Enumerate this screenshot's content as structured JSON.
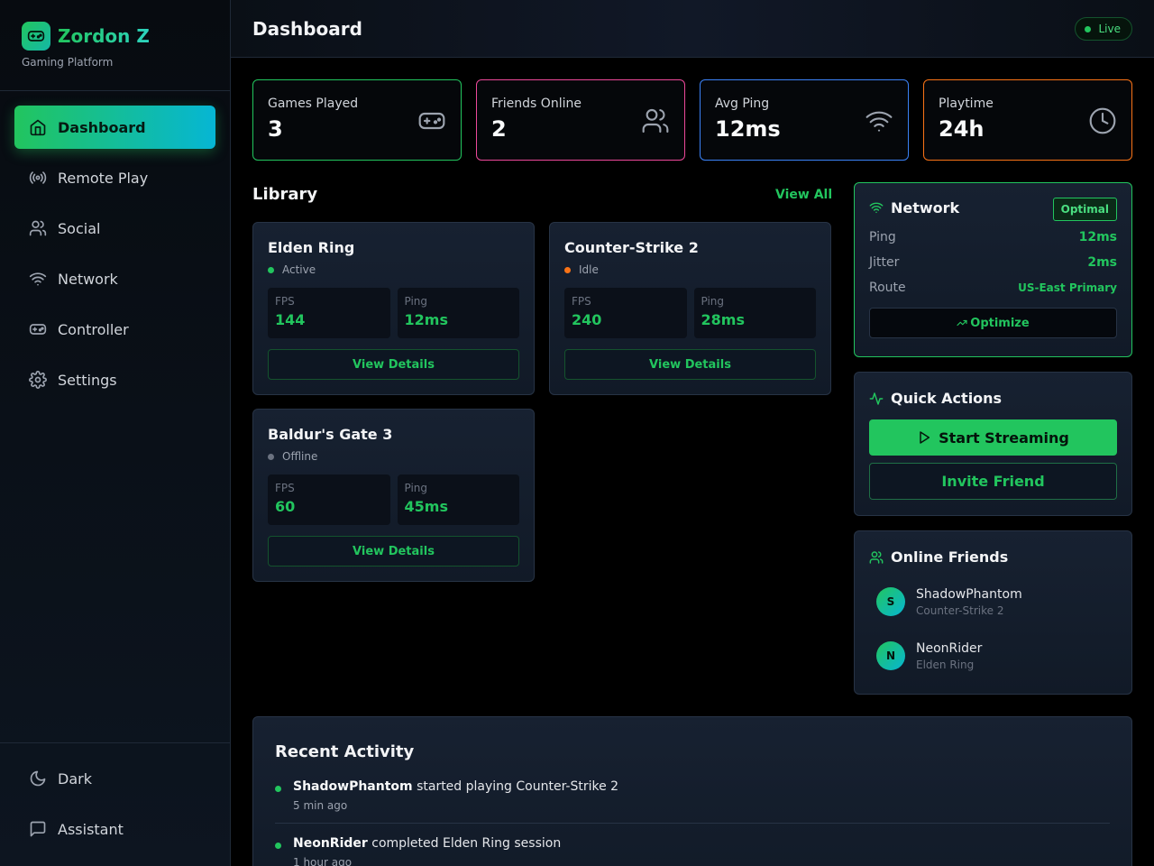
{
  "brand": {
    "name": "Zordon Z",
    "subtitle": "Gaming Platform"
  },
  "nav": {
    "items": [
      {
        "label": "Dashboard",
        "icon": "home-icon",
        "active": true
      },
      {
        "label": "Remote Play",
        "icon": "broadcast-icon"
      },
      {
        "label": "Social",
        "icon": "users-icon"
      },
      {
        "label": "Network",
        "icon": "wifi-icon"
      },
      {
        "label": "Controller",
        "icon": "gamepad-icon"
      },
      {
        "label": "Settings",
        "icon": "gear-icon"
      }
    ],
    "bottom": [
      {
        "label": "Dark",
        "icon": "moon-icon"
      },
      {
        "label": "Assistant",
        "icon": "chat-icon"
      }
    ]
  },
  "header": {
    "title": "Dashboard",
    "badge": "Live"
  },
  "stats": [
    {
      "label": "Games Played",
      "value": "3",
      "icon": "gamepad-icon",
      "color": "#22c55e"
    },
    {
      "label": "Friends Online",
      "value": "2",
      "icon": "users-icon",
      "color": "#ec4899"
    },
    {
      "label": "Avg Ping",
      "value": "12ms",
      "icon": "wifi-icon",
      "color": "#3b82f6"
    },
    {
      "label": "Playtime",
      "value": "24h",
      "icon": "clock-icon",
      "color": "#f97316"
    }
  ],
  "library": {
    "title": "Library",
    "view_all": "View All",
    "games": [
      {
        "title": "Elden Ring",
        "status": "Active",
        "status_color": "#22c55e",
        "fps_label": "FPS",
        "fps": "144",
        "ping_label": "Ping",
        "ping": "12ms",
        "button": "View Details"
      },
      {
        "title": "Counter-Strike 2",
        "status": "Idle",
        "status_color": "#f97316",
        "fps_label": "FPS",
        "fps": "240",
        "ping_label": "Ping",
        "ping": "28ms",
        "button": "View Details"
      },
      {
        "title": "Baldur's Gate 3",
        "status": "Offline",
        "status_color": "#6b7280",
        "fps_label": "FPS",
        "fps": "60",
        "ping_label": "Ping",
        "ping": "45ms",
        "button": "View Details"
      }
    ]
  },
  "network": {
    "title": "Network",
    "badge": "Optimal",
    "rows": [
      {
        "label": "Ping",
        "value": "12ms"
      },
      {
        "label": "Jitter",
        "value": "2ms"
      },
      {
        "label": "Route",
        "value": "US-East Primary"
      }
    ],
    "button": "Optimize"
  },
  "quick_actions": {
    "title": "Quick Actions",
    "primary": "Start Streaming",
    "secondary": "Invite Friend"
  },
  "friends": {
    "title": "Online Friends",
    "items": [
      {
        "initial": "S",
        "name": "ShadowPhantom",
        "game": "Counter-Strike 2"
      },
      {
        "initial": "N",
        "name": "NeonRider",
        "game": "Elden Ring"
      }
    ]
  },
  "activity": {
    "title": "Recent Activity",
    "items": [
      {
        "user": "ShadowPhantom",
        "text": " started playing Counter-Strike 2",
        "time": "5 min ago"
      },
      {
        "user": "NeonRider",
        "text": " completed Elden Ring session",
        "time": "1 hour ago"
      }
    ]
  }
}
